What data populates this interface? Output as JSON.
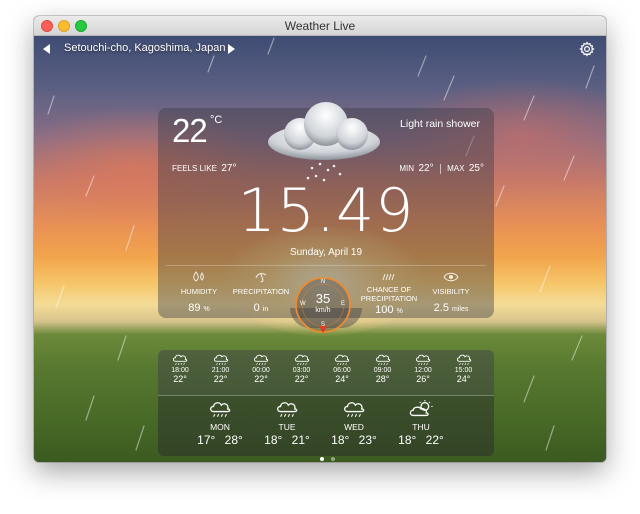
{
  "window": {
    "title": "Weather Live"
  },
  "header": {
    "location": "Setouchi-cho, Kagoshima, Japan"
  },
  "current": {
    "temperature": "22",
    "unit": "°C",
    "condition": "Light rain shower",
    "feels_like_label": "FEELS LIKE",
    "feels_like": "27°",
    "min_label": "MIN",
    "min": "22°",
    "max_label": "MAX",
    "max": "25°",
    "time": "15.49",
    "date": "Sunday, April 19"
  },
  "stats": {
    "humidity": {
      "label": "HUMIDITY",
      "value": "89",
      "unit": "%"
    },
    "precipitation": {
      "label": "PRECIPITATION",
      "value": "0",
      "unit": "in"
    },
    "wind": {
      "value": "35",
      "unit": "km/h",
      "n": "N",
      "e": "E",
      "s": "S",
      "w": "W"
    },
    "chance": {
      "label_line1": "CHANCE OF",
      "label_line2": "PRECIPITATION",
      "value": "100",
      "unit": "%"
    },
    "visibility": {
      "label": "VISIBILITY",
      "value": "2.5",
      "unit": "miles"
    }
  },
  "hourly": [
    {
      "time": "18:00",
      "temp": "22°",
      "icon": "rain-icon"
    },
    {
      "time": "21:00",
      "temp": "22°",
      "icon": "rain-icon"
    },
    {
      "time": "00:00",
      "temp": "22°",
      "icon": "rain-icon"
    },
    {
      "time": "03:00",
      "temp": "22°",
      "icon": "rain-icon"
    },
    {
      "time": "06:00",
      "temp": "24°",
      "icon": "rain-icon"
    },
    {
      "time": "09:00",
      "temp": "28°",
      "icon": "rain-icon"
    },
    {
      "time": "12:00",
      "temp": "26°",
      "icon": "rain-icon"
    },
    {
      "time": "15:00",
      "temp": "24°",
      "icon": "rain-icon"
    }
  ],
  "daily": [
    {
      "name": "MON",
      "low": "17°",
      "high": "28°",
      "icon": "rain-icon"
    },
    {
      "name": "TUE",
      "low": "18°",
      "high": "21°",
      "icon": "rain-icon"
    },
    {
      "name": "WED",
      "low": "18°",
      "high": "23°",
      "icon": "rain-icon"
    },
    {
      "name": "THU",
      "low": "18°",
      "high": "22°",
      "icon": "partly-sunny-icon"
    }
  ],
  "colors": {
    "accent": "#f08a2c",
    "compass_needle": "#e23a1e"
  }
}
